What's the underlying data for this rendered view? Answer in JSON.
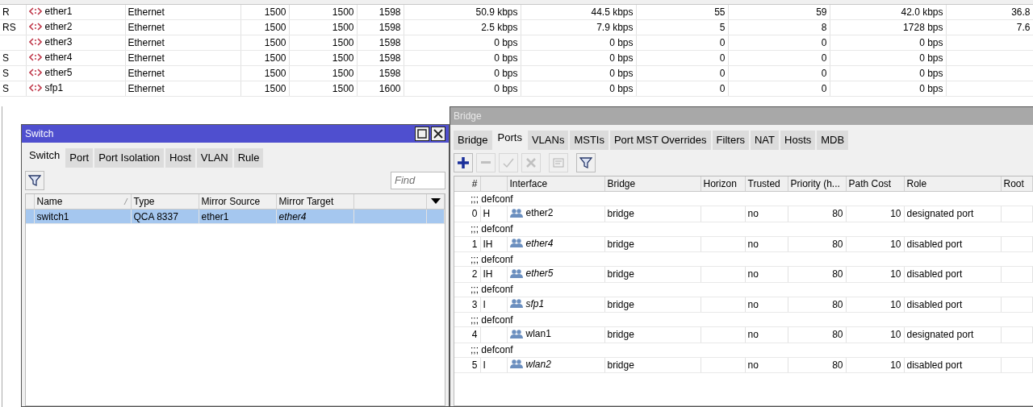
{
  "interfaces": {
    "rows": [
      {
        "flags": "R",
        "name": "ether1",
        "type": "Ethernet",
        "mtu": "1500",
        "actual_mtu": "1500",
        "l2_mtu": "1598",
        "tx": "50.9 kbps",
        "rx": "44.5 kbps",
        "tx_packet": "55",
        "rx_packet": "59",
        "fp_tx": "42.0 kbps",
        "fp_rx": "36.8"
      },
      {
        "flags": "RS",
        "name": "ether2",
        "type": "Ethernet",
        "mtu": "1500",
        "actual_mtu": "1500",
        "l2_mtu": "1598",
        "tx": "2.5 kbps",
        "rx": "7.9 kbps",
        "tx_packet": "5",
        "rx_packet": "8",
        "fp_tx": "1728 bps",
        "fp_rx": "7.6"
      },
      {
        "flags": "",
        "name": "ether3",
        "type": "Ethernet",
        "mtu": "1500",
        "actual_mtu": "1500",
        "l2_mtu": "1598",
        "tx": "0 bps",
        "rx": "0 bps",
        "tx_packet": "0",
        "rx_packet": "0",
        "fp_tx": "0 bps",
        "fp_rx": ""
      },
      {
        "flags": "S",
        "name": "ether4",
        "type": "Ethernet",
        "mtu": "1500",
        "actual_mtu": "1500",
        "l2_mtu": "1598",
        "tx": "0 bps",
        "rx": "0 bps",
        "tx_packet": "0",
        "rx_packet": "0",
        "fp_tx": "0 bps",
        "fp_rx": ""
      },
      {
        "flags": "S",
        "name": "ether5",
        "type": "Ethernet",
        "mtu": "1500",
        "actual_mtu": "1500",
        "l2_mtu": "1598",
        "tx": "0 bps",
        "rx": "0 bps",
        "tx_packet": "0",
        "rx_packet": "0",
        "fp_tx": "0 bps",
        "fp_rx": ""
      },
      {
        "flags": "S",
        "name": "sfp1",
        "type": "Ethernet",
        "mtu": "1500",
        "actual_mtu": "1500",
        "l2_mtu": "1600",
        "tx": "0 bps",
        "rx": "0 bps",
        "tx_packet": "0",
        "rx_packet": "0",
        "fp_tx": "0 bps",
        "fp_rx": ""
      }
    ]
  },
  "switch_window": {
    "title": "Switch",
    "active": true,
    "tabs": [
      {
        "label": "Switch",
        "selected": true
      },
      {
        "label": "Port",
        "selected": false
      },
      {
        "label": "Port Isolation",
        "selected": false
      },
      {
        "label": "Host",
        "selected": false
      },
      {
        "label": "VLAN",
        "selected": false
      },
      {
        "label": "Rule",
        "selected": false
      }
    ],
    "find_placeholder": "Find",
    "columns": [
      "Name",
      "Type",
      "Mirror Source",
      "Mirror Target"
    ],
    "rows": [
      {
        "name": "switch1",
        "type": "QCA 8337",
        "mirror_source": "ether1",
        "mirror_target": "ether4",
        "mirror_target_disabled": true,
        "selected": true
      }
    ]
  },
  "bridge_window": {
    "title": "Bridge",
    "active": false,
    "tabs": [
      {
        "label": "Bridge",
        "selected": false
      },
      {
        "label": "Ports",
        "selected": true
      },
      {
        "label": "VLANs",
        "selected": false
      },
      {
        "label": "MSTIs",
        "selected": false
      },
      {
        "label": "Port MST Overrides",
        "selected": false
      },
      {
        "label": "Filters",
        "selected": false
      },
      {
        "label": "NAT",
        "selected": false
      },
      {
        "label": "Hosts",
        "selected": false
      },
      {
        "label": "MDB",
        "selected": false
      }
    ],
    "toolbar": [
      {
        "kind": "add",
        "disabled": false
      },
      {
        "kind": "remove",
        "disabled": true
      },
      {
        "kind": "enable",
        "disabled": true
      },
      {
        "kind": "disable",
        "disabled": true
      },
      {
        "kind": "comment",
        "disabled": true
      },
      {
        "kind": "filter",
        "disabled": false
      }
    ],
    "columns": [
      "#",
      "",
      "Interface",
      "Bridge",
      "Horizon",
      "Trusted",
      "Priority (h...",
      "Path Cost",
      "Role",
      "Root"
    ],
    "rows": [
      {
        "comment": ";;; defconf",
        "number": "0",
        "flags": "H",
        "interface": "ether2",
        "disabled": false,
        "bridge": "bridge",
        "trusted": "no",
        "priority": "80",
        "path_cost": "10",
        "role": "designated port"
      },
      {
        "comment": ";;; defconf",
        "number": "1",
        "flags": "IH",
        "interface": "ether4",
        "disabled": true,
        "bridge": "bridge",
        "trusted": "no",
        "priority": "80",
        "path_cost": "10",
        "role": "disabled port"
      },
      {
        "comment": ";;; defconf",
        "number": "2",
        "flags": "IH",
        "interface": "ether5",
        "disabled": true,
        "bridge": "bridge",
        "trusted": "no",
        "priority": "80",
        "path_cost": "10",
        "role": "disabled port"
      },
      {
        "comment": ";;; defconf",
        "number": "3",
        "flags": "I",
        "interface": "sfp1",
        "disabled": true,
        "bridge": "bridge",
        "trusted": "no",
        "priority": "80",
        "path_cost": "10",
        "role": "disabled port"
      },
      {
        "comment": ";;; defconf",
        "number": "4",
        "flags": "",
        "interface": "wlan1",
        "disabled": false,
        "bridge": "bridge",
        "trusted": "no",
        "priority": "80",
        "path_cost": "10",
        "role": "designated port"
      },
      {
        "comment": ";;; defconf",
        "number": "5",
        "flags": "I",
        "interface": "wlan2",
        "disabled": true,
        "bridge": "bridge",
        "trusted": "no",
        "priority": "80",
        "path_cost": "10",
        "role": "disabled port"
      }
    ]
  }
}
